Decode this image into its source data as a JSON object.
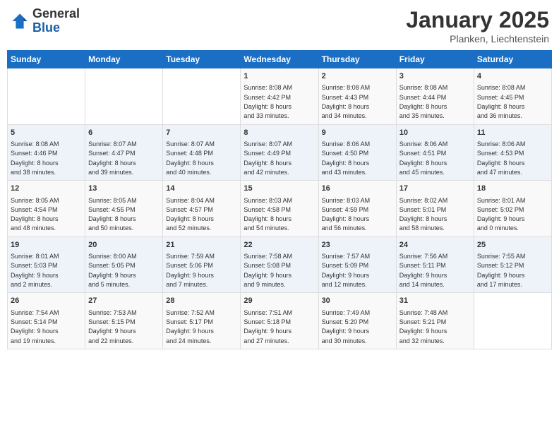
{
  "header": {
    "logo_general": "General",
    "logo_blue": "Blue",
    "month": "January 2025",
    "location": "Planken, Liechtenstein"
  },
  "days_of_week": [
    "Sunday",
    "Monday",
    "Tuesday",
    "Wednesday",
    "Thursday",
    "Friday",
    "Saturday"
  ],
  "weeks": [
    [
      {
        "day": "",
        "info": ""
      },
      {
        "day": "",
        "info": ""
      },
      {
        "day": "",
        "info": ""
      },
      {
        "day": "1",
        "info": "Sunrise: 8:08 AM\nSunset: 4:42 PM\nDaylight: 8 hours\nand 33 minutes."
      },
      {
        "day": "2",
        "info": "Sunrise: 8:08 AM\nSunset: 4:43 PM\nDaylight: 8 hours\nand 34 minutes."
      },
      {
        "day": "3",
        "info": "Sunrise: 8:08 AM\nSunset: 4:44 PM\nDaylight: 8 hours\nand 35 minutes."
      },
      {
        "day": "4",
        "info": "Sunrise: 8:08 AM\nSunset: 4:45 PM\nDaylight: 8 hours\nand 36 minutes."
      }
    ],
    [
      {
        "day": "5",
        "info": "Sunrise: 8:08 AM\nSunset: 4:46 PM\nDaylight: 8 hours\nand 38 minutes."
      },
      {
        "day": "6",
        "info": "Sunrise: 8:07 AM\nSunset: 4:47 PM\nDaylight: 8 hours\nand 39 minutes."
      },
      {
        "day": "7",
        "info": "Sunrise: 8:07 AM\nSunset: 4:48 PM\nDaylight: 8 hours\nand 40 minutes."
      },
      {
        "day": "8",
        "info": "Sunrise: 8:07 AM\nSunset: 4:49 PM\nDaylight: 8 hours\nand 42 minutes."
      },
      {
        "day": "9",
        "info": "Sunrise: 8:06 AM\nSunset: 4:50 PM\nDaylight: 8 hours\nand 43 minutes."
      },
      {
        "day": "10",
        "info": "Sunrise: 8:06 AM\nSunset: 4:51 PM\nDaylight: 8 hours\nand 45 minutes."
      },
      {
        "day": "11",
        "info": "Sunrise: 8:06 AM\nSunset: 4:53 PM\nDaylight: 8 hours\nand 47 minutes."
      }
    ],
    [
      {
        "day": "12",
        "info": "Sunrise: 8:05 AM\nSunset: 4:54 PM\nDaylight: 8 hours\nand 48 minutes."
      },
      {
        "day": "13",
        "info": "Sunrise: 8:05 AM\nSunset: 4:55 PM\nDaylight: 8 hours\nand 50 minutes."
      },
      {
        "day": "14",
        "info": "Sunrise: 8:04 AM\nSunset: 4:57 PM\nDaylight: 8 hours\nand 52 minutes."
      },
      {
        "day": "15",
        "info": "Sunrise: 8:03 AM\nSunset: 4:58 PM\nDaylight: 8 hours\nand 54 minutes."
      },
      {
        "day": "16",
        "info": "Sunrise: 8:03 AM\nSunset: 4:59 PM\nDaylight: 8 hours\nand 56 minutes."
      },
      {
        "day": "17",
        "info": "Sunrise: 8:02 AM\nSunset: 5:01 PM\nDaylight: 8 hours\nand 58 minutes."
      },
      {
        "day": "18",
        "info": "Sunrise: 8:01 AM\nSunset: 5:02 PM\nDaylight: 9 hours\nand 0 minutes."
      }
    ],
    [
      {
        "day": "19",
        "info": "Sunrise: 8:01 AM\nSunset: 5:03 PM\nDaylight: 9 hours\nand 2 minutes."
      },
      {
        "day": "20",
        "info": "Sunrise: 8:00 AM\nSunset: 5:05 PM\nDaylight: 9 hours\nand 5 minutes."
      },
      {
        "day": "21",
        "info": "Sunrise: 7:59 AM\nSunset: 5:06 PM\nDaylight: 9 hours\nand 7 minutes."
      },
      {
        "day": "22",
        "info": "Sunrise: 7:58 AM\nSunset: 5:08 PM\nDaylight: 9 hours\nand 9 minutes."
      },
      {
        "day": "23",
        "info": "Sunrise: 7:57 AM\nSunset: 5:09 PM\nDaylight: 9 hours\nand 12 minutes."
      },
      {
        "day": "24",
        "info": "Sunrise: 7:56 AM\nSunset: 5:11 PM\nDaylight: 9 hours\nand 14 minutes."
      },
      {
        "day": "25",
        "info": "Sunrise: 7:55 AM\nSunset: 5:12 PM\nDaylight: 9 hours\nand 17 minutes."
      }
    ],
    [
      {
        "day": "26",
        "info": "Sunrise: 7:54 AM\nSunset: 5:14 PM\nDaylight: 9 hours\nand 19 minutes."
      },
      {
        "day": "27",
        "info": "Sunrise: 7:53 AM\nSunset: 5:15 PM\nDaylight: 9 hours\nand 22 minutes."
      },
      {
        "day": "28",
        "info": "Sunrise: 7:52 AM\nSunset: 5:17 PM\nDaylight: 9 hours\nand 24 minutes."
      },
      {
        "day": "29",
        "info": "Sunrise: 7:51 AM\nSunset: 5:18 PM\nDaylight: 9 hours\nand 27 minutes."
      },
      {
        "day": "30",
        "info": "Sunrise: 7:49 AM\nSunset: 5:20 PM\nDaylight: 9 hours\nand 30 minutes."
      },
      {
        "day": "31",
        "info": "Sunrise: 7:48 AM\nSunset: 5:21 PM\nDaylight: 9 hours\nand 32 minutes."
      },
      {
        "day": "",
        "info": ""
      }
    ]
  ]
}
